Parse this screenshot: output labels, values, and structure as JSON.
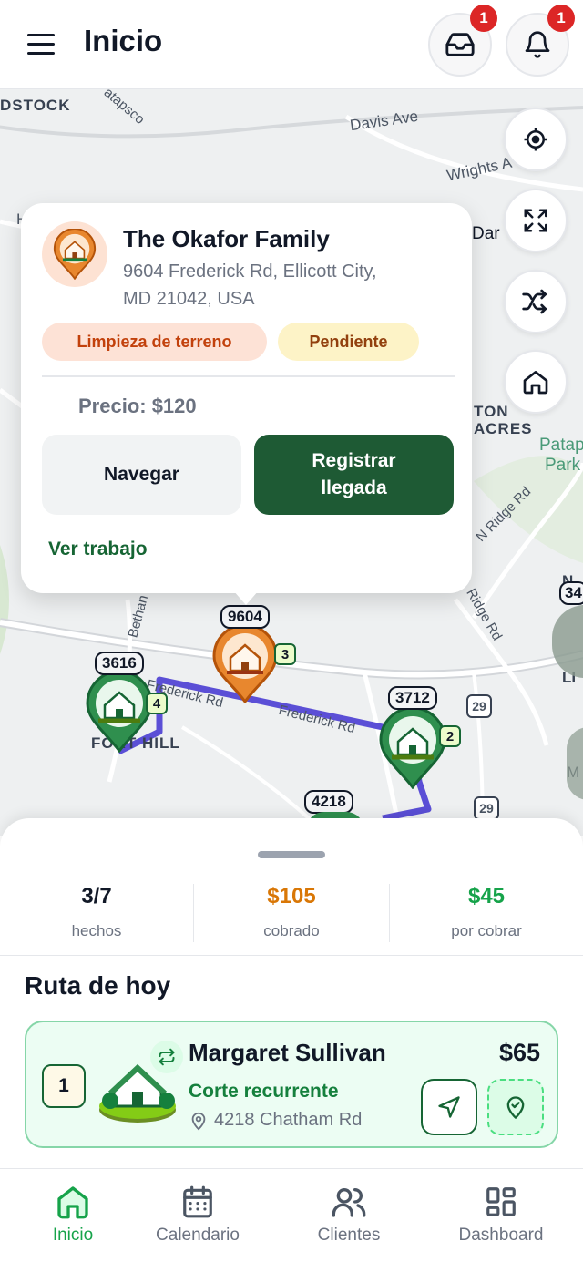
{
  "header": {
    "title": "Inicio",
    "inbox_badge": "1",
    "notifications_badge": "1"
  },
  "map": {
    "labels": {
      "dstock": "DSTOCK",
      "patapsco": "atapsco",
      "davis": "Davis Ave",
      "wrights": "Wrights A",
      "dar": "Dar",
      "h": "H",
      "ton": "TON",
      "acres": "ACRES",
      "patap": "Patap",
      "park": "Park",
      "ridge1": "N Ridge Rd",
      "ridge2": "Ridge Rd",
      "bethany": "Bethan",
      "frederick1": "Frederick Rd",
      "frederick2": "Frederick Rd",
      "fort_hill": "FORT HILL",
      "no": "N",
      "li": "LI",
      "m": "M",
      "shield29a": "29",
      "shield29b": "29"
    },
    "pins": [
      {
        "label": "9604",
        "order": "3"
      },
      {
        "label": "3616",
        "order": "4"
      },
      {
        "label": "3712",
        "order": "2"
      },
      {
        "label": "4218"
      },
      {
        "label": "34"
      }
    ]
  },
  "popup": {
    "name": "The Okafor Family",
    "address": "9604 Frederick Rd, Ellicott City, MD 21042, USA",
    "service_tag": "Limpieza de terreno",
    "status_tag": "Pendiente",
    "price": "Precio: $120",
    "navigate_label": "Navegar",
    "checkin_label": "Registrar llegada",
    "view_job_label": "Ver trabajo"
  },
  "stats": {
    "done_value": "3/7",
    "done_label": "hechos",
    "collected_value": "$105",
    "collected_label": "cobrado",
    "pending_value": "$45",
    "pending_label": "por cobrar"
  },
  "route": {
    "title": "Ruta de hoy",
    "item": {
      "order": "1",
      "name": "Margaret Sullivan",
      "service": "Corte recurrente",
      "address": "4218 Chatham Rd",
      "price": "$65"
    }
  },
  "nav": {
    "items": [
      {
        "label": "Inicio"
      },
      {
        "label": "Calendario"
      },
      {
        "label": "Clientes"
      },
      {
        "label": "Dashboard"
      }
    ]
  },
  "colors": {
    "brand_green": "#166534",
    "accent_orange": "#d97706",
    "route_purple": "#5b4fd6"
  },
  "icons": {
    "menu": "hamburger-icon",
    "inbox": "inbox-icon",
    "bell": "bell-icon",
    "locate": "crosshair-icon",
    "expand": "expand-icon",
    "shuffle": "shuffle-icon",
    "home": "home-icon",
    "navigate": "navigation-arrow-icon",
    "checkin": "map-pin-check-icon",
    "recurring": "repeat-icon",
    "location": "map-pin-icon"
  }
}
